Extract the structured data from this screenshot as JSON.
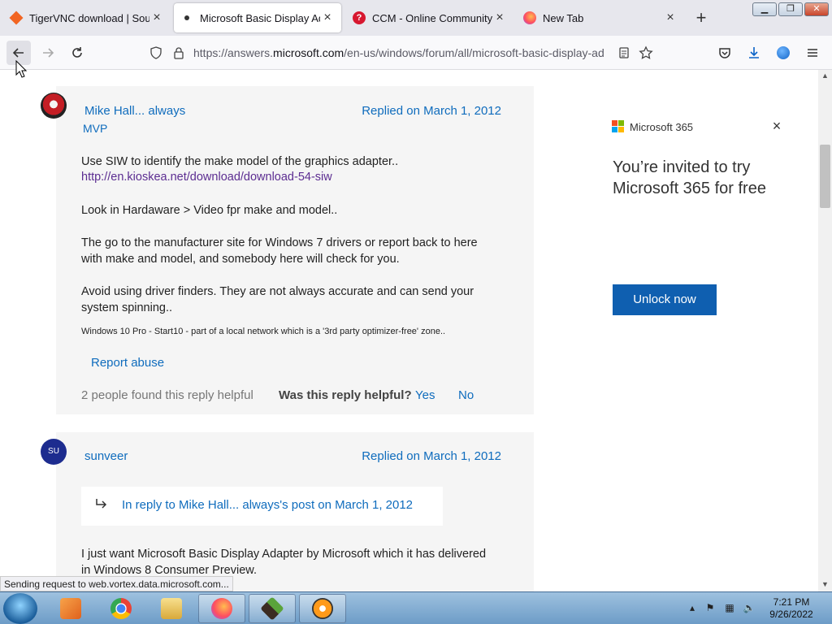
{
  "browser": {
    "tabs": [
      {
        "title": "TigerVNC download | Source",
        "active": false
      },
      {
        "title": "Microsoft Basic Display Adap",
        "active": true
      },
      {
        "title": "CCM - Online Community",
        "active": false
      },
      {
        "title": "New Tab",
        "active": false
      }
    ],
    "new_tab_label": "+",
    "close_glyph": "×",
    "url_prefix": "https://answers.",
    "url_domain": "microsoft.com",
    "url_path": "/en-us/windows/forum/all/microsoft-basic-display-ad",
    "status_text": "Sending request to web.vortex.data.microsoft.com..."
  },
  "post1": {
    "author": "Mike Hall... always",
    "role": "MVP",
    "replied": "Replied on March 1, 2012",
    "line1": "Use SIW to identify the make model of the graphics adapter..",
    "link": "http://en.kioskea.net/download/download-54-siw",
    "line2": "Look in Hardaware > Video fpr make and model..",
    "line3a": "The go to the manufacturer site for Windows 7 drivers or report back to here",
    "line3b": "with make and model, and somebody here will check for you.",
    "line4a": "Avoid using driver finders. They are not always accurate and can send your",
    "line4b": "system spinning..",
    "signature": "Windows 10 Pro - Start10 - part of a local network which is a '3rd party optimizer-free' zone..",
    "report_abuse": "Report abuse",
    "helpful_count": "2 people found this reply helpful",
    "helpful_question": "Was this reply helpful?",
    "yes": "Yes",
    "no": "No"
  },
  "post2": {
    "avatar_initials": "SU",
    "author": "sunveer",
    "replied": "Replied on March 1, 2012",
    "in_reply_to": "In reply to Mike Hall... always's post on March 1, 2012",
    "line1": "I just want Microsoft Basic Display Adapter by Microsoft which it has delivered",
    "line2": "in Windows 8 Consumer Preview."
  },
  "ad": {
    "brand": "Microsoft 365",
    "headline": "You’re invited to try Microsoft 365 for free",
    "cta": "Unlock now",
    "close_glyph": "×"
  },
  "taskbar": {
    "time": "7:21 PM",
    "date": "9/26/2022",
    "items": [
      "media-player",
      "chrome",
      "file-explorer",
      "firefox",
      "minecraft",
      "app"
    ]
  },
  "colors": {
    "link_blue": "#0f6cbd",
    "cta_blue": "#0f5fb0",
    "visited_link": "#5c2d91"
  }
}
